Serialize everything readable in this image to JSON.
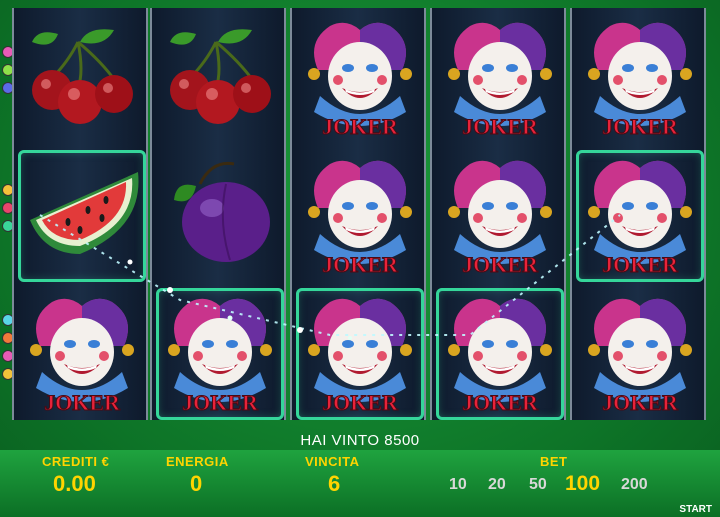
{
  "status": {
    "won_text": "HAI VINTO 8500"
  },
  "meters": {
    "credits_label": "CREDITI €",
    "credits_value": "0.00",
    "energy_label": "ENERGIA",
    "energy_value": "0",
    "win_label": "VINCITA",
    "win_value": "6"
  },
  "bet": {
    "label": "BET",
    "options": [
      "10",
      "20",
      "50",
      "100",
      "200"
    ],
    "selected": "100"
  },
  "start_label": "START",
  "joker_text": "JOKER",
  "reels": [
    [
      "cherry-icon",
      "watermelon-icon",
      "joker-icon"
    ],
    [
      "cherry-icon",
      "plum-icon",
      "joker-icon"
    ],
    [
      "joker-icon",
      "joker-icon",
      "joker-icon"
    ],
    [
      "joker-icon",
      "joker-icon",
      "joker-icon"
    ],
    [
      "joker-icon",
      "joker-icon",
      "joker-icon"
    ]
  ],
  "winning_cells": [
    [
      0,
      1
    ],
    [
      1,
      2
    ],
    [
      2,
      2
    ],
    [
      3,
      2
    ],
    [
      4,
      1
    ]
  ],
  "colors": {
    "accent": "#ffd400",
    "win_frame": "#35d69a",
    "felt": "#0f7a2a"
  }
}
